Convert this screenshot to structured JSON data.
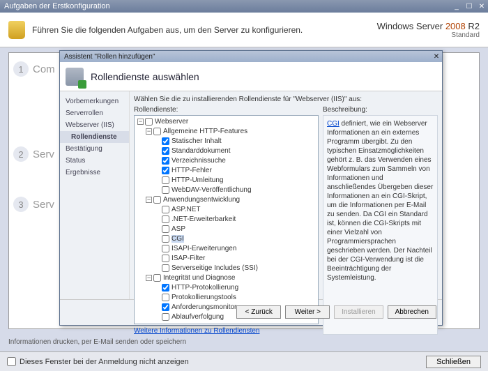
{
  "outer": {
    "title": "Aufgaben der Erstkonfiguration",
    "banner": "Führen Sie die folgenden Aufgaben aus, um den Server zu konfigurieren.",
    "brand_line1_a": "Windows Server",
    "brand_line1_b": "2008",
    "brand_line1_c": "R2",
    "brand_line2": "Standard",
    "task1": "Com",
    "task2": "Serv",
    "task3": "Serv",
    "footer": "Informationen drucken, per E-Mail senden oder speichern",
    "checkbox_label": "Dieses Fenster bei der Anmeldung nicht anzeigen",
    "close": "Schließen"
  },
  "wizard": {
    "title": "Assistent \"Rollen hinzufügen\"",
    "header": "Rollendienste auswählen",
    "nav": {
      "item0": "Vorbemerkungen",
      "item1": "Serverrollen",
      "item2": "Webserver (IIS)",
      "item3": "Rollendienste",
      "item4": "Bestätigung",
      "item5": "Status",
      "item6": "Ergebnisse"
    },
    "instruction": "Wählen Sie die zu installierenden Rollendienste für \"Webserver (IIS)\" aus:",
    "tree_label": "Rollendienste:",
    "desc_label": "Beschreibung:",
    "tree_link": "Weitere Informationen zu Rollendiensten",
    "desc_link": "CGI",
    "desc_body": " definiert, wie ein Webserver Informationen an ein externes Programm übergibt. Zu den typischen Einsatzmöglichkeiten gehört z. B. das Verwenden eines Webformulars zum Sammeln von Informationen und anschließendes Übergeben dieser Informationen an ein CGI-Skript, um die Informationen per E-Mail zu senden. Da CGI ein Standard ist, können die CGI-Skripts mit einer Vielzahl von Programmiersprachen geschrieben werden. Der Nachteil bei der CGI-Verwendung ist die Beeinträchtigung der Systemleistung.",
    "buttons": {
      "back": "< Zurück",
      "next": "Weiter >",
      "install": "Installieren",
      "cancel": "Abbrechen"
    },
    "tree": [
      {
        "ind": 0,
        "pm": "-",
        "chk": "mixed",
        "label": "Webserver"
      },
      {
        "ind": 1,
        "pm": "-",
        "chk": "mixed",
        "label": "Allgemeine HTTP-Features"
      },
      {
        "ind": 2,
        "pm": "",
        "chk": "on",
        "label": "Statischer Inhalt"
      },
      {
        "ind": 2,
        "pm": "",
        "chk": "on",
        "label": "Standarddokument"
      },
      {
        "ind": 2,
        "pm": "",
        "chk": "on",
        "label": "Verzeichnissuche"
      },
      {
        "ind": 2,
        "pm": "",
        "chk": "on",
        "label": "HTTP-Fehler"
      },
      {
        "ind": 2,
        "pm": "",
        "chk": "off",
        "label": "HTTP-Umleitung"
      },
      {
        "ind": 2,
        "pm": "",
        "chk": "off",
        "label": "WebDAV-Veröffentlichung"
      },
      {
        "ind": 1,
        "pm": "-",
        "chk": "off",
        "label": "Anwendungsentwicklung"
      },
      {
        "ind": 2,
        "pm": "",
        "chk": "off",
        "label": "ASP.NET"
      },
      {
        "ind": 2,
        "pm": "",
        "chk": "off",
        "label": ".NET-Erweiterbarkeit"
      },
      {
        "ind": 2,
        "pm": "",
        "chk": "off",
        "label": "ASP"
      },
      {
        "ind": 2,
        "pm": "",
        "chk": "off",
        "label": "CGI",
        "sel": true
      },
      {
        "ind": 2,
        "pm": "",
        "chk": "off",
        "label": "ISAPI-Erweiterungen"
      },
      {
        "ind": 2,
        "pm": "",
        "chk": "off",
        "label": "ISAP-Filter"
      },
      {
        "ind": 2,
        "pm": "",
        "chk": "off",
        "label": "Serverseitige Includes (SSI)"
      },
      {
        "ind": 1,
        "pm": "-",
        "chk": "mixed",
        "label": "Integrität und Diagnose"
      },
      {
        "ind": 2,
        "pm": "",
        "chk": "on",
        "label": "HTTP-Protokollierung"
      },
      {
        "ind": 2,
        "pm": "",
        "chk": "off",
        "label": "Protokollierungstools"
      },
      {
        "ind": 2,
        "pm": "",
        "chk": "on",
        "label": "Anforderungsmonitor"
      },
      {
        "ind": 2,
        "pm": "",
        "chk": "off",
        "label": "Ablaufverfolgung"
      }
    ]
  }
}
